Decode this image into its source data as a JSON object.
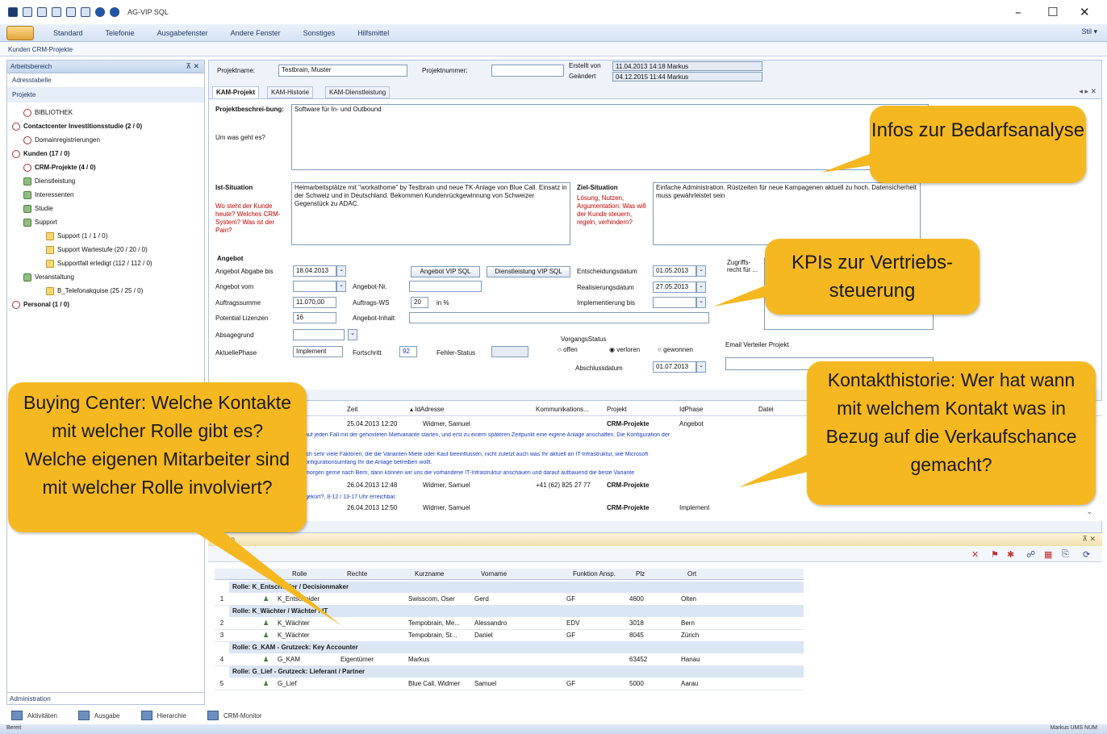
{
  "app": {
    "title": "AG-VIP SQL",
    "menu_right": "Stil"
  },
  "menu": [
    "Standard",
    "Telefonie",
    "Ausgabefenster",
    "Andere Fenster",
    "Sonstiges",
    "Hilfsmittel"
  ],
  "breadcrumb": "Kunden CRM-Projekte",
  "left": {
    "header": "Arbeitsbereich",
    "nav": [
      "Adresstabelle",
      "Projekte"
    ],
    "tree": [
      {
        "label": "BIBLIOTHEK",
        "bold": false,
        "red": false,
        "indent": 1,
        "icon": "project"
      },
      {
        "label": "Contactcenter Investitionsstudie (2 / 0)",
        "bold": true,
        "red": false,
        "indent": 0,
        "icon": "project"
      },
      {
        "label": "Domainregistrierungen",
        "bold": false,
        "red": false,
        "indent": 1,
        "icon": "project"
      },
      {
        "label": "Kunden (17 / 0)",
        "bold": true,
        "red": false,
        "indent": 0,
        "icon": "project"
      },
      {
        "label": "CRM-Projekte (4 / 0)",
        "bold": true,
        "red": false,
        "indent": 1,
        "icon": "project"
      },
      {
        "label": "Dienstleistung",
        "bold": false,
        "red": false,
        "indent": 1,
        "icon": "people"
      },
      {
        "label": "Interessenten",
        "bold": false,
        "red": false,
        "indent": 1,
        "icon": "people"
      },
      {
        "label": "Studie",
        "bold": false,
        "red": false,
        "indent": 1,
        "icon": "people"
      },
      {
        "label": "Support",
        "bold": false,
        "red": false,
        "indent": 1,
        "icon": "people"
      },
      {
        "label": "Support (1 / 1 / 0)",
        "bold": false,
        "red": false,
        "indent": 3,
        "icon": "folder"
      },
      {
        "label": "Support Wartestufe (20 / 20 / 0)",
        "bold": false,
        "red": false,
        "indent": 3,
        "icon": "folder"
      },
      {
        "label": "Supportfall erledigt (112 / 112 / 0)",
        "bold": false,
        "red": false,
        "indent": 3,
        "icon": "folder"
      },
      {
        "label": "Veranstaltung",
        "bold": false,
        "red": false,
        "indent": 1,
        "icon": "people"
      },
      {
        "label": "B_Telefonakquise (25 / 25 / 0)",
        "bold": false,
        "red": false,
        "indent": 3,
        "icon": "folder"
      },
      {
        "label": "Personal (1 / 0)",
        "bold": true,
        "red": false,
        "indent": 0,
        "icon": "project"
      }
    ],
    "admin": "Administration"
  },
  "bottom_tabs": [
    "Aktivitäten",
    "Ausgabe",
    "Hierarchie",
    "CRM-Monitor"
  ],
  "status": {
    "left": "Bereit",
    "right": "Markus  UMS  NUM"
  },
  "project": {
    "name_label": "Projektname:",
    "name_value": "Testbrain, Muster",
    "number_label": "Projektnummer:",
    "number_value": "",
    "created_label": "Erstellt von",
    "created_value": "11.04.2013 14:18 Markus",
    "changed_label": "Geändert",
    "changed_value": "04.12.2015 11:44 Markus"
  },
  "tabs": [
    "KAM-Projekt",
    "KAM-Historie",
    "KAM-Dienstleistung"
  ],
  "form": {
    "desc_label": "Projektbeschrei-bung:",
    "desc_value": "Software für In- und Outbound",
    "question_label": "Um was geht es?",
    "ist_label": "Ist-Situation",
    "ist_hint": "Wo steht der Kunde heute? Welches CRM-System? Was ist der Pain?",
    "ist_value": "Heimarbeitsplätze mit \"workathome\" by Testbrain und neue TK-Anlage von Blue Call. Einsatz in der Schweiz und in Deutschland. Bekommen Kundenrückgewinnung von Schweizer Gegenstück zu ADAC.",
    "ziel_label": "Ziel-Situation",
    "ziel_hint": "Lösung, Nutzen, Argumentation: Was will der Kunde steuern, regeln, verhindern?",
    "ziel_value": "Einfache Administration. Rüstzeiten für neue Kampagenen aktuell zu hoch. Datensicherheit muss gewährleistet sein",
    "angebot_label": "Angebot",
    "abgabe_label": "Angebot Abgabe bis",
    "abgabe_value": "18.04.2013",
    "vom_label": "Angebot vom",
    "vom_value": "",
    "auftrag_label": "Auftragssumme",
    "auftrag_value": "11.070,00",
    "lizenzen_label": "Potential Lizenzen",
    "lizenzen_value": "16",
    "absage_label": "Absagegrund",
    "absage_value": "",
    "phase_label": "AktuellePhase",
    "phase_value": "Implement",
    "btn_angebot": "Angebot VIP SQL",
    "btn_dienst": "Dienstleistung VIP SQL",
    "angebotnr_label": "Angebot-Nr.",
    "angebotnr_value": "",
    "auftragws_label": "Auftrags-WS",
    "auftragws_value": "20",
    "percent_label": "in %",
    "inhalt_label": "Angebot-Inhalt",
    "inhalt_value": "",
    "fortschritt_label": "Fortschritt",
    "fortschritt_value": "92",
    "fehler_label": "Fehler-Status",
    "fehler_value": "",
    "entscheid_label": "Entscheidungsdatum",
    "entscheid_value": "01.05.2013",
    "realisierung_label": "Realisierungsdatum",
    "realisierung_value": "27.05.2013",
    "implement_label": "Implementierung bis",
    "implement_value": "",
    "vorgang_label": "VorgangsStatus",
    "radio_offen": "offen",
    "radio_verloren": "verloren",
    "radio_gewonnen": "gewonnen",
    "abschluss_label": "Abschlussdatum",
    "abschluss_value": "01.07.2013",
    "zugriff_label": "Zugriffs-recht für ...",
    "email_label": "Email Verteiler Projekt"
  },
  "history": {
    "columns": [
      "Zeit",
      "IdAdresse",
      "Kommunikations...",
      "Projekt",
      "IdPhase",
      "Datei"
    ],
    "rows": [
      {
        "zeit": "25.04.2013 12:20",
        "adresse": "Widmer, Samuel",
        "komm": "",
        "projekt": "CRM-Projekte",
        "phase": "Angebot"
      },
      {
        "zeit": "26.04.2013 12:48",
        "adresse": "Widmer, Samuel",
        "komm": "+41 (62) 825 27 77",
        "projekt": "CRM-Projekte",
        "phase": ""
      },
      {
        "zeit": "26.04.2013 12:50",
        "adresse": "Widmer, Samuel",
        "komm": "",
        "projekt": "CRM-Projekte",
        "phase": "Implement"
      }
    ],
    "texts": [
      "auf jeden Fall mit der gehosteten Mietvariante starten, und erst zu einem späteren Zeitpunkt eine eigene Anlage anschaffen. Die Konfiguration der",
      "ich sehr viele Faktoren, die die Varianten Miete oder Kauf beeinflussen, nicht zuletzt auch was Ihr aktuell an IT-Infrastruktur, wie Microsoft",
      "onfigurationsumfang Ihr die Anlage betreiben wollt.",
      "morgen gerne nach Bern, dann können wir uns die vorhandene IT-Infrastruktur anschauen und darauf aufbauend die beste Variante",
      "gekürt?, 8-12 / 13-17 Uhr erreichbar."
    ]
  },
  "rolegrid": {
    "title": "rungen",
    "columns": [
      "Rolle",
      "Rechte",
      "Kurzname",
      "Vorname",
      "Funktion Ansp.",
      "Plz",
      "Ort"
    ],
    "groups": [
      {
        "title": "Rolle: K_Entscheider / Decisionmaker",
        "rows": [
          {
            "no": "1",
            "rolle": "K_Entscheider",
            "rechte": "",
            "kurz": "Swisscom, Oser",
            "vor": "Gerd",
            "funk": "GF",
            "plz": "4600",
            "ort": "Olten"
          }
        ]
      },
      {
        "title": "Rolle: K_Wächter / Wächter / IT",
        "rows": [
          {
            "no": "2",
            "rolle": "K_Wächter",
            "rechte": "",
            "kurz": "Tempobrain, Me...",
            "vor": "Alessandro",
            "funk": "EDV",
            "plz": "3018",
            "ort": "Bern"
          },
          {
            "no": "3",
            "rolle": "K_Wächter",
            "rechte": "",
            "kurz": "Tempobrain, St...",
            "vor": "Daniel",
            "funk": "GF",
            "plz": "8045",
            "ort": "Zürich"
          }
        ]
      },
      {
        "title": "Rolle: G_KAM - Grutzeck: Key Accounter",
        "rows": [
          {
            "no": "4",
            "rolle": "G_KAM",
            "rechte": "Eigentümer",
            "kurz": "Markus",
            "vor": "",
            "funk": "",
            "plz": "63452",
            "ort": "Hanau"
          }
        ]
      },
      {
        "title": "Rolle: G_Lief - Grutzeck: Lieferant / Partner",
        "rows": [
          {
            "no": "5",
            "rolle": "G_Lief",
            "rechte": "",
            "kurz": "Blue Call, Widmer",
            "vor": "Samuel",
            "funk": "GF",
            "plz": "5000",
            "ort": "Aarau"
          }
        ]
      }
    ]
  },
  "callouts": {
    "bedarf": "Infos zur Bedarfsanalyse",
    "kpi": "KPIs zur Vertriebs-steuerung",
    "kontakt": "Kontakthistorie: Wer hat wann mit welchem Kontakt was in Bezug auf die Verkaufschance gemacht?",
    "buying": "Buying Center: Welche Kontakte mit welcher Rolle gibt es? Welche eigenen Mitarbeiter sind mit welcher Rolle involviert?"
  },
  "colors": {
    "callout": "#f5b821",
    "accent": "#1f3a66",
    "red_hint": "#c00000",
    "link": "#1a3cc0"
  }
}
